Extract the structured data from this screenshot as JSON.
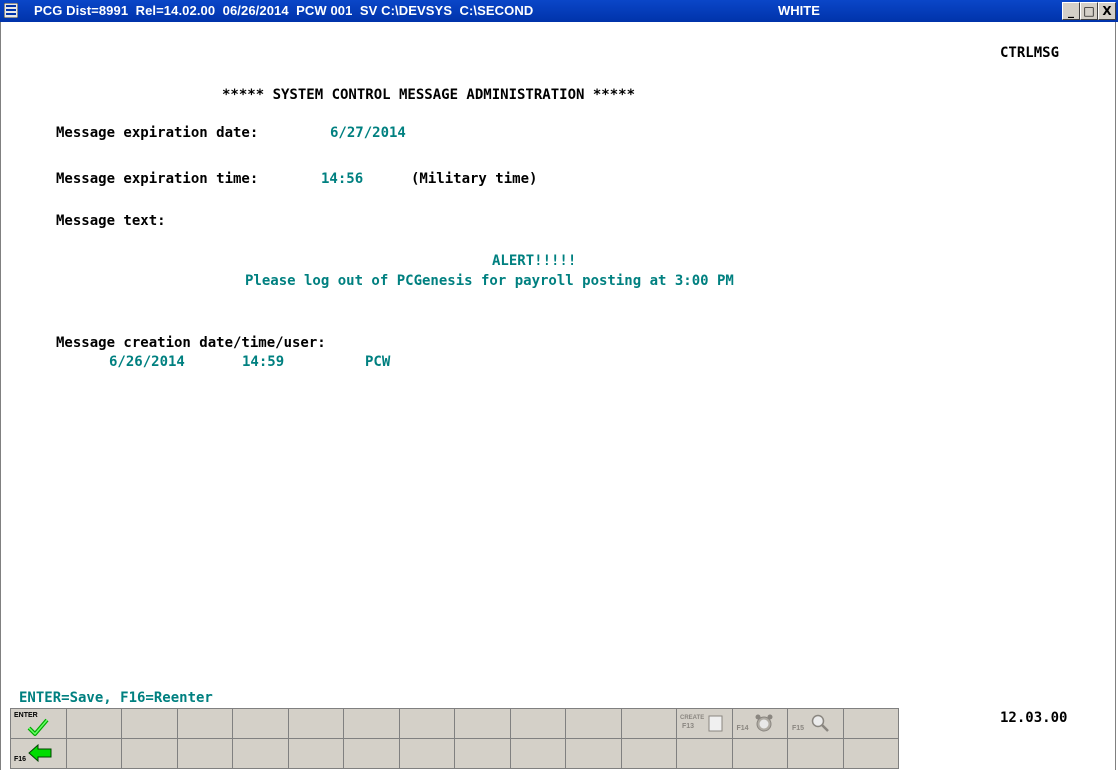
{
  "titlebar": {
    "title": "PCG Dist=8991  Rel=14.02.00  06/26/2014  PCW 001  SV C:\\DEVSYS  C:\\SECOND",
    "theme": "WHITE",
    "minimize": "_",
    "maximize": "□",
    "close": "X"
  },
  "screen": {
    "program_id": "CTRLMSG",
    "heading": "***** SYSTEM CONTROL MESSAGE ADMINISTRATION *****",
    "expiration_date_label": "Message expiration date:",
    "expiration_date_value": "6/27/2014",
    "expiration_time_label": "Message expiration time:",
    "expiration_time_value": "14:56",
    "expiration_time_note": "(Military time)",
    "message_text_label": "Message text:",
    "message_line1": "ALERT!!!!!",
    "message_line2": "Please log out of PCGenesis for payroll posting at 3:00 PM",
    "creation_label": "Message creation date/time/user:",
    "creation_date": "6/26/2014",
    "creation_time": "14:59",
    "creation_user": "PCW",
    "hint": "ENTER=Save, F16=Reenter",
    "version": "12.03.00"
  },
  "function_keys": {
    "enter_label": "ENTER",
    "f16_label": "F16",
    "f13_label_top": "CREATE",
    "f13_label_bottom": "F13",
    "f14_label": "F14",
    "f15_label": "F15",
    "icons": [
      "enter-checkmark-icon",
      "f16-back-arrow-icon",
      "f13-create-icon",
      "f14-alarm-clock-icon",
      "f15-magnifier-icon"
    ]
  },
  "colors": {
    "titlebar": "#0033aa",
    "label": "#000000",
    "value": "#008080",
    "key_bg": "#d4d0c8",
    "arrow_green": "#00cc00"
  }
}
